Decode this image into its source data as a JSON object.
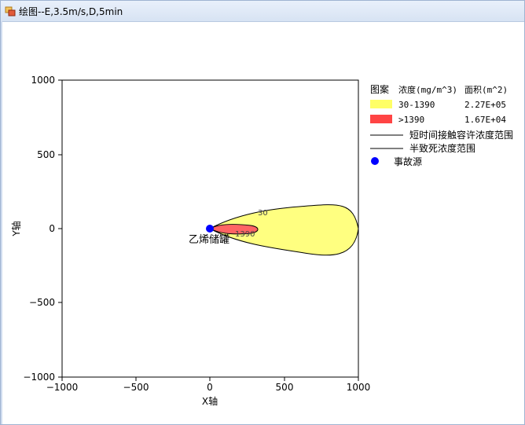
{
  "window": {
    "title": "绘图--E,3.5m/s,D,5min"
  },
  "chart_data": {
    "type": "area",
    "xlabel": "X轴",
    "ylabel": "Y轴",
    "xlim": [
      -1000,
      1000
    ],
    "ylim": [
      -1000,
      1000
    ],
    "x_ticks": [
      "−1000",
      "−500",
      "0",
      "500",
      "1000"
    ],
    "y_ticks": [
      "1000",
      "500",
      "0",
      "−500",
      "−1000"
    ],
    "legend": {
      "placement": "right",
      "header": {
        "col1": "图案",
        "col2": "浓度(mg/m^3)",
        "col3": "面积(m^2)"
      },
      "entries": [
        {
          "label": "30-1390",
          "area": "2.27E+05",
          "color": "#ffff66"
        },
        {
          "label": ">1390",
          "area": "1.67E+04",
          "color": "#ff4444"
        }
      ],
      "lines": [
        {
          "label": "短时间接触容许浓度范围"
        },
        {
          "label": "半致死浓度范围"
        }
      ],
      "source": {
        "label": "事故源",
        "color": "#0000ff"
      }
    },
    "source_point": {
      "x": 0,
      "y": 0,
      "label": "乙烯储罐"
    },
    "contours": [
      {
        "label": "30",
        "color": "#ffff80",
        "x_min": 0,
        "x_max": 1000,
        "max_half_width": 175
      },
      {
        "label": "1390",
        "color": "#ff6464",
        "x_min": 0,
        "x_max": 340,
        "max_half_width": 35
      }
    ]
  }
}
